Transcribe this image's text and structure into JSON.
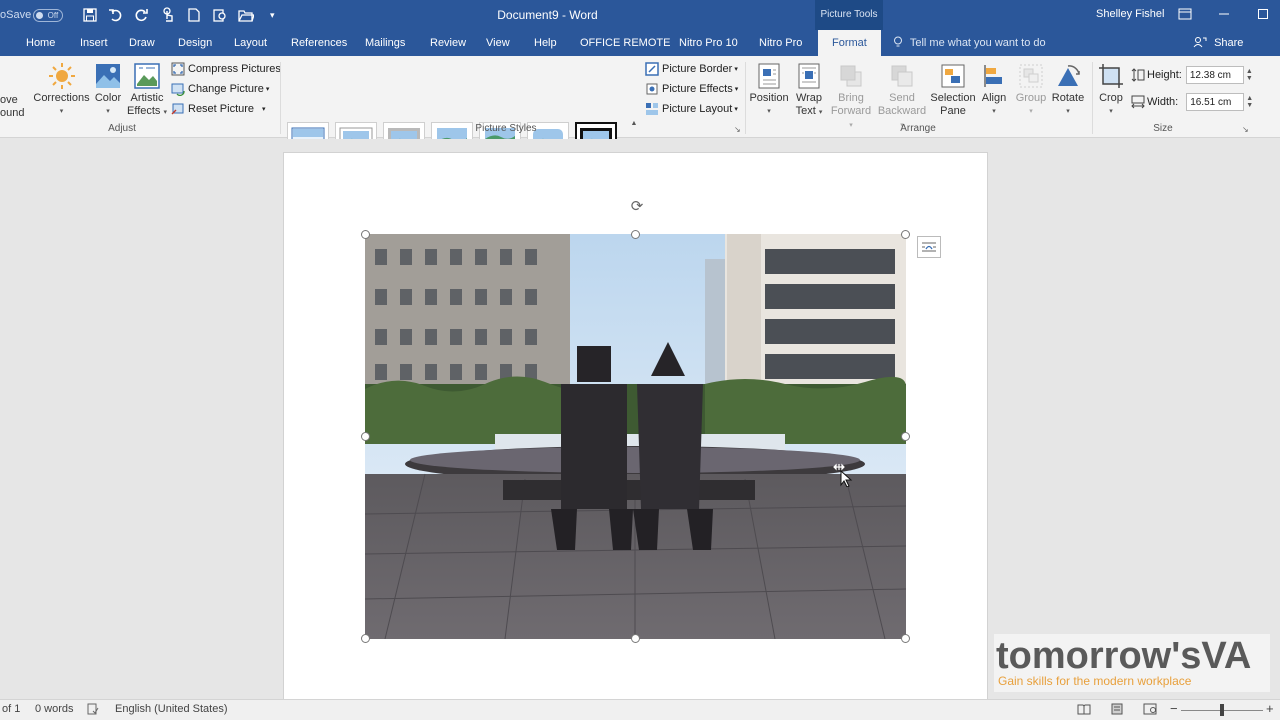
{
  "titlebar": {
    "autosave_label": "oSave",
    "autosave_state": "Off",
    "document_title": "Document9 - Word",
    "context_label": "Picture Tools",
    "user_name": "Shelley Fishel"
  },
  "tabs": [
    {
      "label": "Home"
    },
    {
      "label": "Insert"
    },
    {
      "label": "Draw"
    },
    {
      "label": "Design"
    },
    {
      "label": "Layout"
    },
    {
      "label": "References"
    },
    {
      "label": "Mailings"
    },
    {
      "label": "Review"
    },
    {
      "label": "View"
    },
    {
      "label": "Help"
    },
    {
      "label": "OFFICE REMOTE"
    },
    {
      "label": "Nitro Pro 10"
    },
    {
      "label": "Nitro Pro"
    },
    {
      "label": "Format"
    }
  ],
  "tellme": "Tell me what you want to do",
  "share_label": "Share",
  "ribbon": {
    "remove_background": [
      "ove",
      "ound"
    ],
    "corrections": "Corrections",
    "color": "Color",
    "artistic_effects": [
      "Artistic",
      "Effects"
    ],
    "compress_pictures": "Compress Pictures",
    "change_picture": "Change Picture",
    "reset_picture": "Reset Picture",
    "adjust_group": "Adjust",
    "picture_styles_group": "Picture Styles",
    "picture_border": "Picture Border",
    "picture_effects": "Picture Effects",
    "picture_layout": "Picture Layout",
    "position": "Position",
    "wrap_text": [
      "Wrap",
      "Text"
    ],
    "bring_forward": [
      "Bring",
      "Forward"
    ],
    "send_backward": [
      "Send",
      "Backward"
    ],
    "selection_pane": [
      "Selection",
      "Pane"
    ],
    "align": "Align",
    "group": "Group",
    "rotate": "Rotate",
    "arrange_group": "Arrange",
    "crop": "Crop",
    "height_label": "Height:",
    "height_value": "12.38 cm",
    "width_label": "Width:",
    "width_value": "16.51 cm",
    "size_group": "Size"
  },
  "status": {
    "page": "of 1",
    "words": "0 words",
    "language": "English (United States)"
  },
  "watermark": {
    "brand": "tomorrow'sVA",
    "tagline": "Gain skills for the modern workplace"
  },
  "colors": {
    "word_blue": "#2b579a",
    "ribbon_bg": "#f3f3f3",
    "accent_orange": "#e8a03c"
  },
  "icons": [
    "save-icon",
    "undo-icon",
    "redo-icon",
    "touch-mode-icon",
    "new-document-icon",
    "print-preview-icon",
    "open-folder-icon",
    "customize-qat-icon",
    "lightbulb-icon",
    "share-icon",
    "rotate-handle-icon",
    "layout-options-icon",
    "move-cursor-icon"
  ]
}
